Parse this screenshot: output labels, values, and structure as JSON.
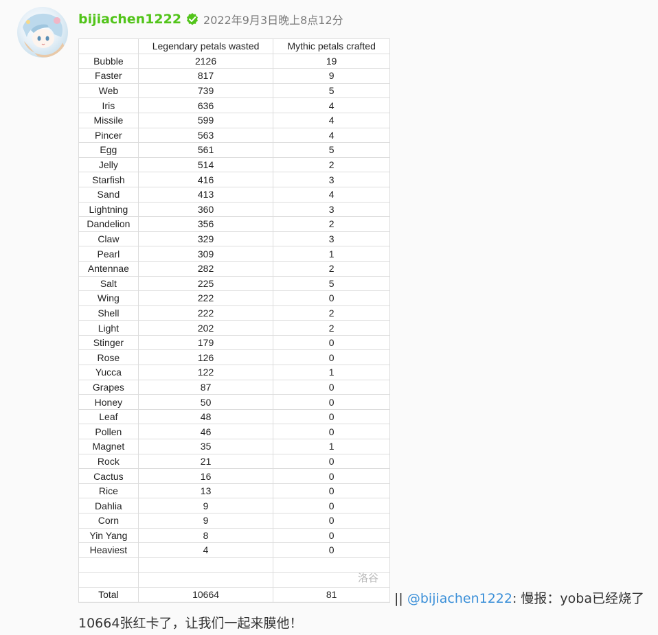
{
  "post": {
    "username": "bijiachen1222",
    "timestamp": "2022年9月3日晚上8点12分",
    "separator": "||",
    "mention": "@bijiachen1222",
    "text_rest": ": 慢报：yoba已经烧了",
    "text_line2": "10664张红卡了，让我们一起来膜他！",
    "username_color": "#52c41a",
    "mention_color": "#3a8fd8"
  },
  "image": {
    "watermark": "洛谷"
  },
  "table": {
    "headers": [
      "",
      "Legendary petals wasted",
      "Mythic petals crafted"
    ],
    "rows": [
      [
        "Bubble",
        "2126",
        "19"
      ],
      [
        "Faster",
        "817",
        "9"
      ],
      [
        "Web",
        "739",
        "5"
      ],
      [
        "Iris",
        "636",
        "4"
      ],
      [
        "Missile",
        "599",
        "4"
      ],
      [
        "Pincer",
        "563",
        "4"
      ],
      [
        "Egg",
        "561",
        "5"
      ],
      [
        "Jelly",
        "514",
        "2"
      ],
      [
        "Starfish",
        "416",
        "3"
      ],
      [
        "Sand",
        "413",
        "4"
      ],
      [
        "Lightning",
        "360",
        "3"
      ],
      [
        "Dandelion",
        "356",
        "2"
      ],
      [
        "Claw",
        "329",
        "3"
      ],
      [
        "Pearl",
        "309",
        "1"
      ],
      [
        "Antennae",
        "282",
        "2"
      ],
      [
        "Salt",
        "225",
        "5"
      ],
      [
        "Wing",
        "222",
        "0"
      ],
      [
        "Shell",
        "222",
        "2"
      ],
      [
        "Light",
        "202",
        "2"
      ],
      [
        "Stinger",
        "179",
        "0"
      ],
      [
        "Rose",
        "126",
        "0"
      ],
      [
        "Yucca",
        "122",
        "1"
      ],
      [
        "Grapes",
        "87",
        "0"
      ],
      [
        "Honey",
        "50",
        "0"
      ],
      [
        "Leaf",
        "48",
        "0"
      ],
      [
        "Pollen",
        "46",
        "0"
      ],
      [
        "Magnet",
        "35",
        "1"
      ],
      [
        "Rock",
        "21",
        "0"
      ],
      [
        "Cactus",
        "16",
        "0"
      ],
      [
        "Rice",
        "13",
        "0"
      ],
      [
        "Dahlia",
        "9",
        "0"
      ],
      [
        "Corn",
        "9",
        "0"
      ],
      [
        "Yin Yang",
        "8",
        "0"
      ],
      [
        "Heaviest",
        "4",
        "0"
      ]
    ],
    "total": [
      "Total",
      "10664",
      "81"
    ]
  }
}
